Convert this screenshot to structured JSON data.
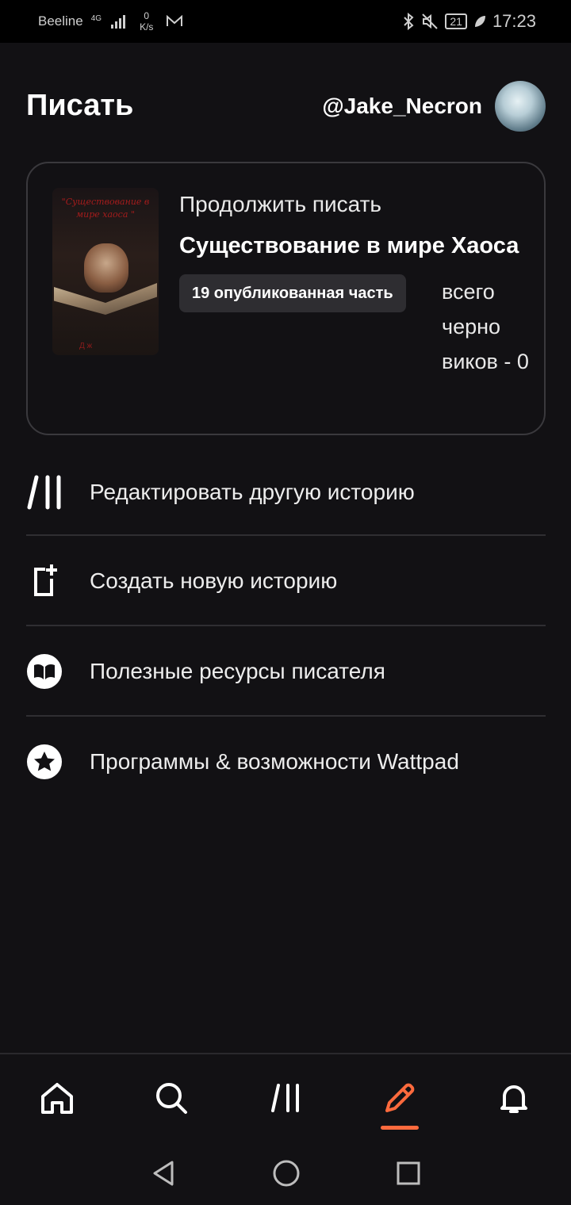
{
  "status_bar": {
    "carrier": "Beeline",
    "network": "4G",
    "speed_value": "0",
    "speed_unit": "K/s",
    "battery": "21",
    "time": "17:23"
  },
  "header": {
    "title": "Писать",
    "username": "@Jake_Necron"
  },
  "continue_card": {
    "label": "Продолжить писать",
    "story_title": "Существование в мире Хаоса",
    "published_parts": "19 опубликованная часть",
    "drafts_text": "всего черно виков - 0",
    "cover_text": "\"Существование в мире хаоса \"",
    "cover_signature": "Д ж"
  },
  "menu": {
    "items": [
      {
        "label": "Редактировать другую историю",
        "icon": "library-icon"
      },
      {
        "label": "Создать новую историю",
        "icon": "new-story-icon"
      },
      {
        "label": "Полезные ресурсы писателя",
        "icon": "book-icon"
      },
      {
        "label": "Программы & возможности Wattpad",
        "icon": "star-icon"
      }
    ]
  },
  "bottom_nav": {
    "items": [
      "home-icon",
      "search-icon",
      "library-icon",
      "write-icon",
      "bell-icon"
    ],
    "active": "write-icon",
    "accent_color": "#ff6a3d"
  },
  "colors": {
    "background": "#121114",
    "card_border": "#3a393d",
    "badge_bg": "#2e2d31"
  }
}
